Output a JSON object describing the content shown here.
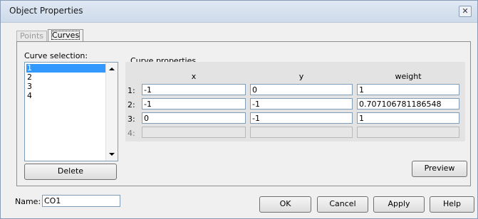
{
  "window": {
    "title": "Object Properties",
    "close_glyph": "✕"
  },
  "tabs": [
    {
      "label": "Points",
      "active": false
    },
    {
      "label": "Curves",
      "active": true
    }
  ],
  "curve_selection": {
    "label": "Curve selection:",
    "items": [
      "1",
      "2",
      "3",
      "4"
    ],
    "selected": "1",
    "delete_label": "Delete"
  },
  "curve_properties": {
    "label": "Curve properties",
    "columns": [
      "x",
      "y",
      "weight"
    ],
    "rows": [
      {
        "label": "1:",
        "x": "-1",
        "y": "0",
        "weight": "1",
        "enabled": true
      },
      {
        "label": "2:",
        "x": "-1",
        "y": "-1",
        "weight": "0.707106781186548",
        "enabled": true
      },
      {
        "label": "3:",
        "x": "0",
        "y": "-1",
        "weight": "1",
        "enabled": true
      },
      {
        "label": "4:",
        "x": "",
        "y": "",
        "weight": "",
        "enabled": false
      }
    ],
    "preview_label": "Preview"
  },
  "name": {
    "label": "Name:",
    "value": "CO1"
  },
  "buttons": {
    "ok": "OK",
    "cancel": "Cancel",
    "apply": "Apply",
    "help": "Help"
  }
}
